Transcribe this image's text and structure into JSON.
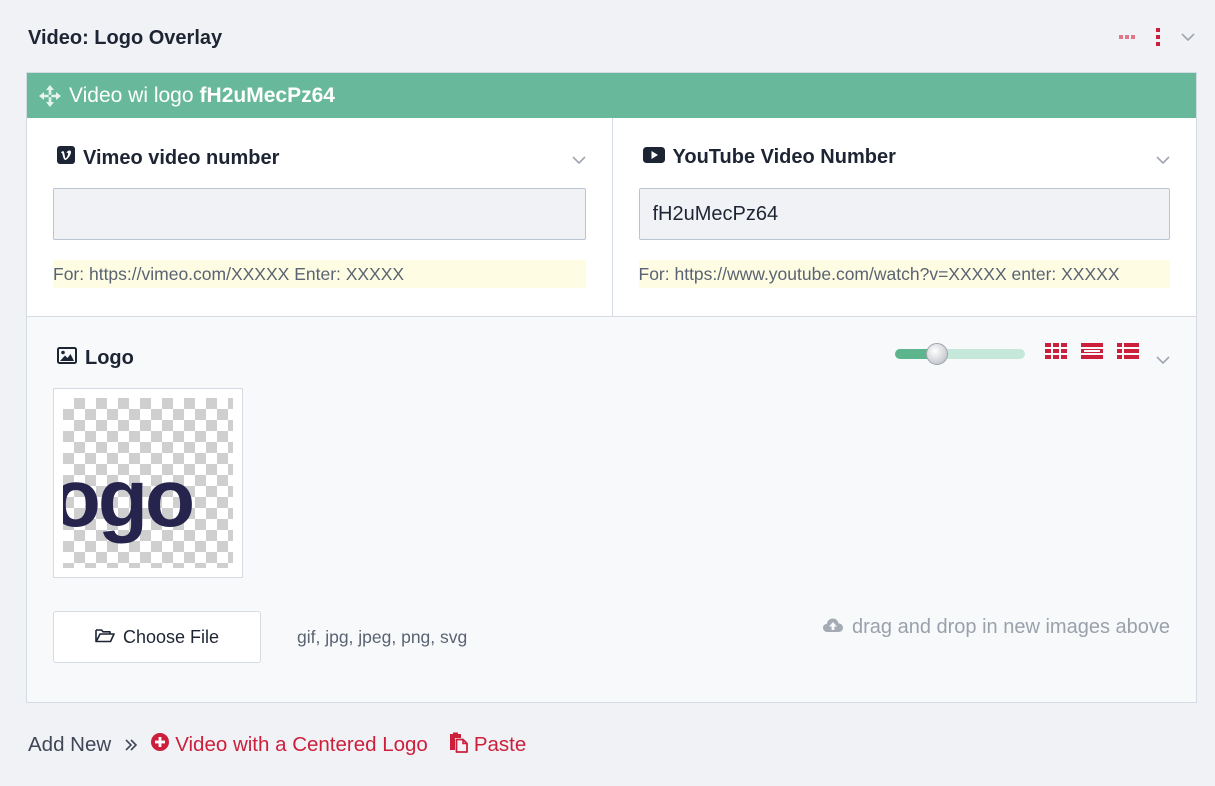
{
  "header": {
    "title": "Video: Logo Overlay"
  },
  "card": {
    "bar_prefix": "Video wi logo",
    "bar_strong": "fH2uMecPz64"
  },
  "vimeo": {
    "label": "Vimeo video number",
    "value": "",
    "hint": "For: https://vimeo.com/XXXXX Enter: XXXXX"
  },
  "youtube": {
    "label": "YouTube Video Number",
    "value": "fH2uMecPz64",
    "hint": "For: https://www.youtube.com/watch?v=XXXXX enter: XXXXX"
  },
  "logo": {
    "label": "Logo",
    "slider_value": 0.32,
    "thumbnail_text": "logo",
    "choose_label": "Choose File",
    "filetypes": "gif, jpg, jpeg, png, svg",
    "dnd_hint": "drag and drop in new images above"
  },
  "footer": {
    "add_new": "Add New",
    "add_link": "Video with a Centered Logo",
    "paste": "Paste"
  },
  "colors": {
    "bar": "#68b89b",
    "accent": "#cc1f3c",
    "hint_bg": "#fefde3",
    "slider_fill": "#5db58e",
    "logo_text": "#26244d"
  },
  "icons": {
    "move": "move-icon",
    "vimeo": "vimeo-icon",
    "youtube": "youtube-icon",
    "image": "image-icon",
    "folder": "folder-open-icon",
    "cloud": "cloud-upload-icon",
    "add": "plus-circle-icon",
    "paste": "paste-icon"
  }
}
